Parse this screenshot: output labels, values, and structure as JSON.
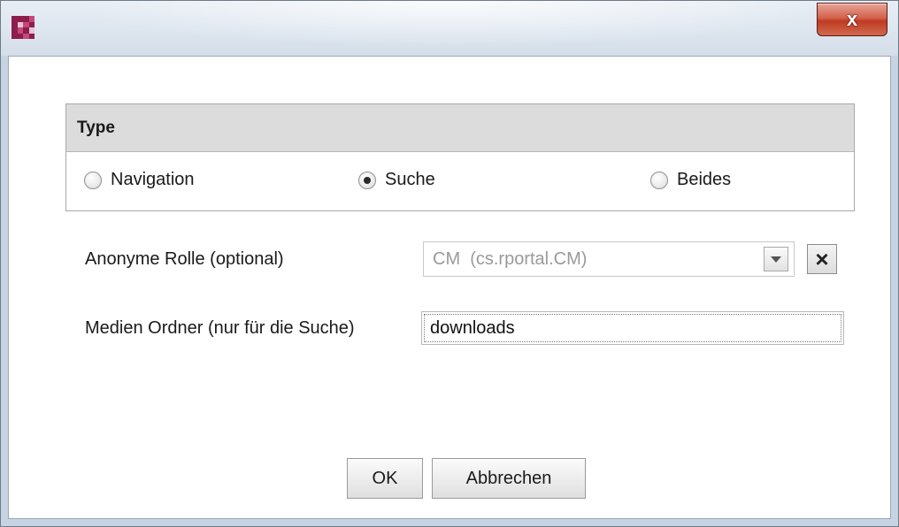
{
  "window": {
    "close_glyph": "x"
  },
  "type_panel": {
    "title": "Type",
    "options": [
      {
        "label": "Navigation",
        "selected": false
      },
      {
        "label": "Suche",
        "selected": true
      },
      {
        "label": "Beides",
        "selected": false
      }
    ]
  },
  "fields": {
    "anonymous_role_label": "Anonyme Rolle (optional)",
    "anonymous_role_value": "CM  (cs.rportal.CM)",
    "clear_glyph": "×",
    "media_folder_label": "Medien Ordner (nur für die Suche)",
    "media_folder_value": "downloads"
  },
  "buttons": {
    "ok": "OK",
    "cancel": "Abbrechen"
  },
  "colors": {
    "app_icon_primary": "#8c1d4d",
    "app_icon_secondary": "#c4487a",
    "close_button": "#c9452c"
  }
}
